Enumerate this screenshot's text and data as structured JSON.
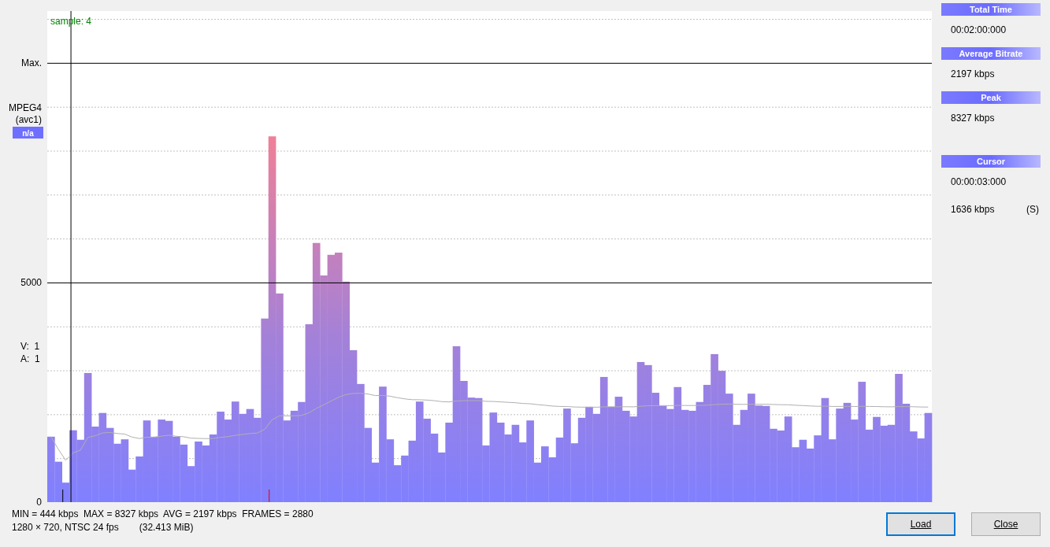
{
  "chart": {
    "codec": "MPEG4",
    "fourcc": "(avc1)",
    "badge": "n/a",
    "streams": [
      {
        "label": "V:",
        "value": "1"
      },
      {
        "label": "A:",
        "value": "1"
      }
    ],
    "chart_data": {
      "type": "bar",
      "ylim": [
        0,
        11180
      ],
      "yticks": [
        {
          "value": 0,
          "label": "0"
        },
        {
          "value": 5000,
          "label": "5000"
        },
        {
          "value": 10000,
          "label": "Max."
        }
      ],
      "series": [
        {
          "color": "#8080ff",
          "values": [
            1490,
            920,
            444,
            1636,
            1420,
            2940,
            1720,
            2030,
            1690,
            1330,
            1430,
            740,
            1040,
            1860,
            1490,
            1880,
            1850,
            1490,
            1310,
            820,
            1380,
            1290,
            1540,
            2060,
            1880,
            2290,
            2010,
            2120,
            1920,
            4180,
            8327,
            4750,
            1860,
            2080,
            2280,
            4050,
            5900,
            5160,
            5630,
            5680,
            5020,
            3460,
            2690,
            1690,
            900,
            2630,
            1430,
            840,
            1060,
            1400,
            2290,
            1900,
            1560,
            1130,
            1810,
            3550,
            2760,
            2380,
            2370,
            1290,
            2040,
            1810,
            1540,
            1760,
            1360,
            1860,
            900,
            1270,
            1020,
            1470,
            2130,
            1340,
            1920,
            2170,
            2010,
            2850,
            2170,
            2400,
            2080,
            1950,
            3190,
            3120,
            2490,
            2190,
            2120,
            2620,
            2100,
            2080,
            2280,
            2670,
            3370,
            2990,
            2470,
            1760,
            2100,
            2470,
            2200,
            2190,
            1670,
            1630,
            1950,
            1250,
            1420,
            1220,
            1520,
            2370,
            1430,
            2130,
            2260,
            1880,
            2740,
            1650,
            1940,
            1740,
            1760,
            2920,
            2240,
            1610,
            1450,
            2030
          ]
        },
        {
          "type": "line",
          "color": "#b0b0b0",
          "values": [
            1490,
            1205,
            951,
            1122,
            1182,
            1475,
            1510,
            1575,
            1587,
            1562,
            1550,
            1482,
            1448,
            1478,
            1479,
            1504,
            1524,
            1499,
            1489,
            1456,
            1452,
            1445,
            1449,
            1474,
            1490,
            1521,
            1540,
            1560,
            1573,
            1660,
            1875,
            1966,
            1963,
            1966,
            1975,
            2032,
            2135,
            2215,
            2302,
            2386,
            2450,
            2474,
            2479,
            2461,
            2426,
            2430,
            2411,
            2378,
            2351,
            2332,
            2331,
            2323,
            2309,
            2288,
            2280,
            2302,
            2310,
            2311,
            2312,
            2295,
            2291,
            2283,
            2271,
            2262,
            2246,
            2240,
            2219,
            2205,
            2188,
            2178,
            2177,
            2166,
            2163,
            2163,
            2160,
            2169,
            2169,
            2172,
            2172,
            2170,
            2183,
            2194,
            2198,
            2198,
            2197,
            2202,
            2201,
            2201,
            2202,
            2207,
            2220,
            2229,
            2232,
            2227,
            2226,
            2229,
            2229,
            2229,
            2224,
            2218,
            2216,
            2206,
            2198,
            2189,
            2183,
            2185,
            2179,
            2179,
            2180,
            2177,
            2182,
            2178,
            2176,
            2172,
            2169,
            2175,
            2175,
            2171,
            2166,
            2165
          ]
        }
      ]
    },
    "cursor": {
      "label": "sample: 4"
    }
  },
  "info_panel": [
    {
      "header": "Total Time",
      "rows": [
        {
          "value": "00:02:00:000"
        }
      ]
    },
    {
      "header": "Average Bitrate",
      "rows": [
        {
          "value": "2197 kbps"
        }
      ]
    },
    {
      "header": "Peak",
      "rows": [
        {
          "value": "8327 kbps"
        }
      ]
    },
    {
      "header": "Cursor",
      "rows": [
        {
          "value": "00:00:03:000"
        },
        {
          "value": "1636 kbps",
          "flag": "(S)"
        }
      ]
    }
  ],
  "summary": {
    "line_1": "MIN = 444 kbps  MAX = 8327 kbps  AVG = 2197 kbps  FRAMES = 2880",
    "line_2": "1280 × 720, NTSC 24 fps",
    "size": "(32.413 MiB)"
  },
  "buttons": [
    {
      "label": "Load",
      "focused": true
    },
    {
      "label": "Close",
      "focused": false
    }
  ]
}
